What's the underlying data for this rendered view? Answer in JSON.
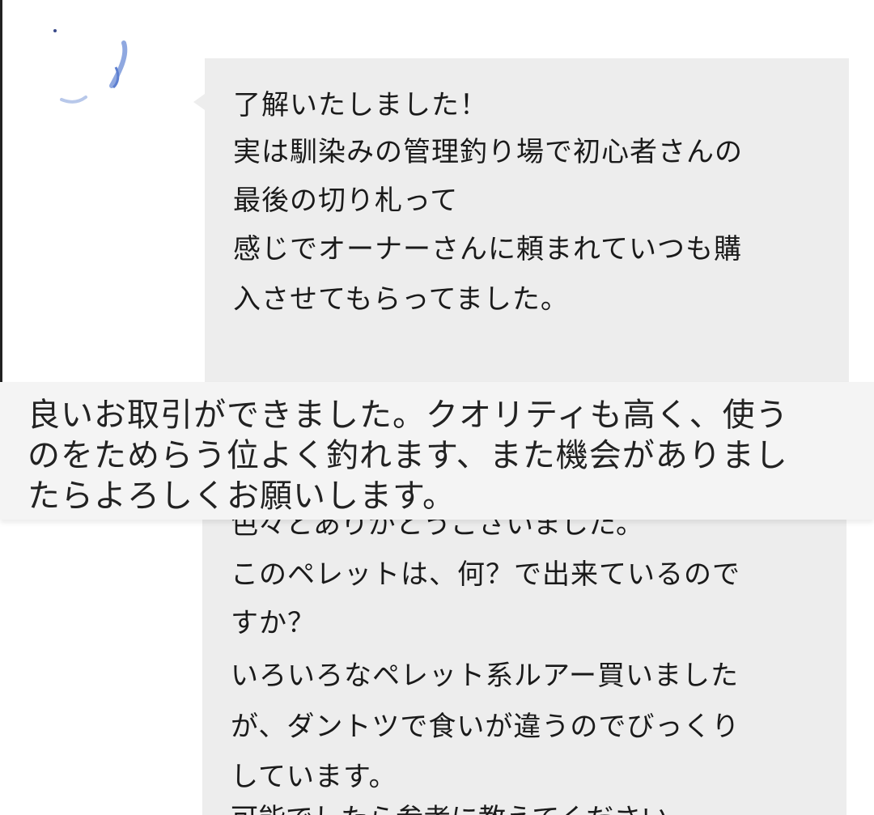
{
  "chat_top": {
    "lines": [
      "了解いたしました！",
      "実は馴染みの管理釣り場で初心者さんの",
      "最後の切り札って",
      "感じでオーナーさんに頼まれていつも購",
      "入させてもらってました。"
    ]
  },
  "review": {
    "lines": [
      "良いお取引ができました。クオリティも高く、使う",
      "のをためらう位よく釣れます、また機会がありまし",
      "たらよろしくお願いします。"
    ]
  },
  "chat_bottom": {
    "partial_top": "色々とありがとうございました。",
    "lines": [
      "このペレットは、何？で出来ているので",
      "すか？",
      "いろいろなペレット系ルアー買いました",
      "が、ダントツで食いが違うのでびっくり",
      "しています。"
    ],
    "partial_bottom": "可能でしたら参考に教えてください"
  },
  "colors": {
    "bubble": "#ededed",
    "review_bg": "#f4f4f4",
    "text": "#1a1a1a"
  }
}
